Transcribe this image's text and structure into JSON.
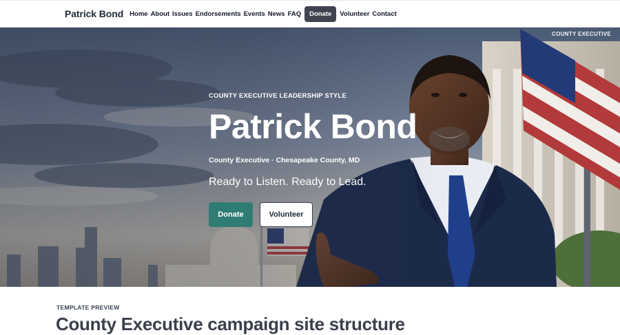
{
  "nav": {
    "brand": "Patrick Bond",
    "links": [
      "Home",
      "About",
      "Issues",
      "Endorsements",
      "Events",
      "News",
      "FAQ"
    ],
    "cta": "Donate",
    "links_after": [
      "Volunteer",
      "Contact"
    ]
  },
  "hero": {
    "corner_tag": "COUNTY EXECUTIVE",
    "eyebrow": "COUNTY EXECUTIVE LEADERSHIP STYLE",
    "title": "Patrick Bond",
    "subtitle": "County Executive · Chesapeake County, MD",
    "tagline": "Ready to Listen. Ready to Lead.",
    "donate_label": "Donate",
    "volunteer_label": "Volunteer",
    "image_subject": "candidate-portrait-with-flag-and-capitol"
  },
  "preview": {
    "label": "TEMPLATE PREVIEW",
    "title": "County Executive campaign site structure"
  },
  "colors": {
    "nav_cta_bg": "#3f4450",
    "donate_bg": "#2f7d72",
    "suit": "#1c2a4a",
    "tie": "#1f3f8a"
  }
}
